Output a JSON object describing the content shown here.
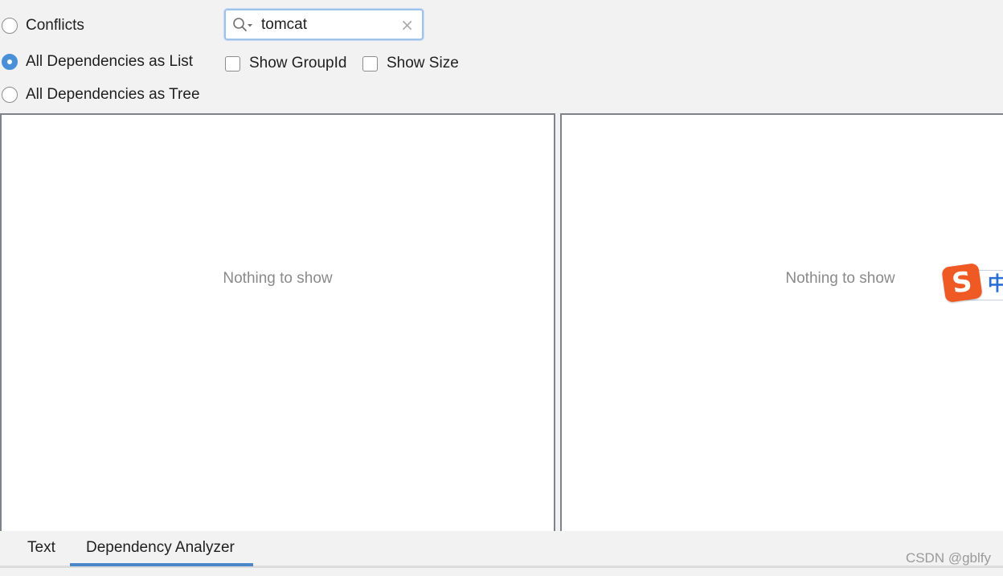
{
  "view_options": {
    "conflicts_label": "Conflicts",
    "list_label": "All Dependencies as List",
    "tree_label": "All Dependencies as Tree",
    "selected": "All Dependencies as List"
  },
  "search": {
    "value": "tomcat",
    "clear_symbol": "×"
  },
  "toggles": {
    "show_groupid_label": "Show GroupId",
    "show_size_label": "Show Size"
  },
  "panels": {
    "left_empty_text": "Nothing to show",
    "right_empty_text": "Nothing to show"
  },
  "ime": {
    "logo_letter": "S",
    "mode_char": "中"
  },
  "tabs": {
    "text_label": "Text",
    "analyzer_label": "Dependency Analyzer",
    "active": "Dependency Analyzer"
  },
  "watermark": "CSDN @gblfy",
  "colors": {
    "accent": "#4a90d9",
    "tab_underline": "#4a86c8",
    "panel_border": "#7e838c",
    "ime_orange": "#ef5a24"
  },
  "icons": [
    "search-icon",
    "clear-icon",
    "ime-logo-icon"
  ]
}
